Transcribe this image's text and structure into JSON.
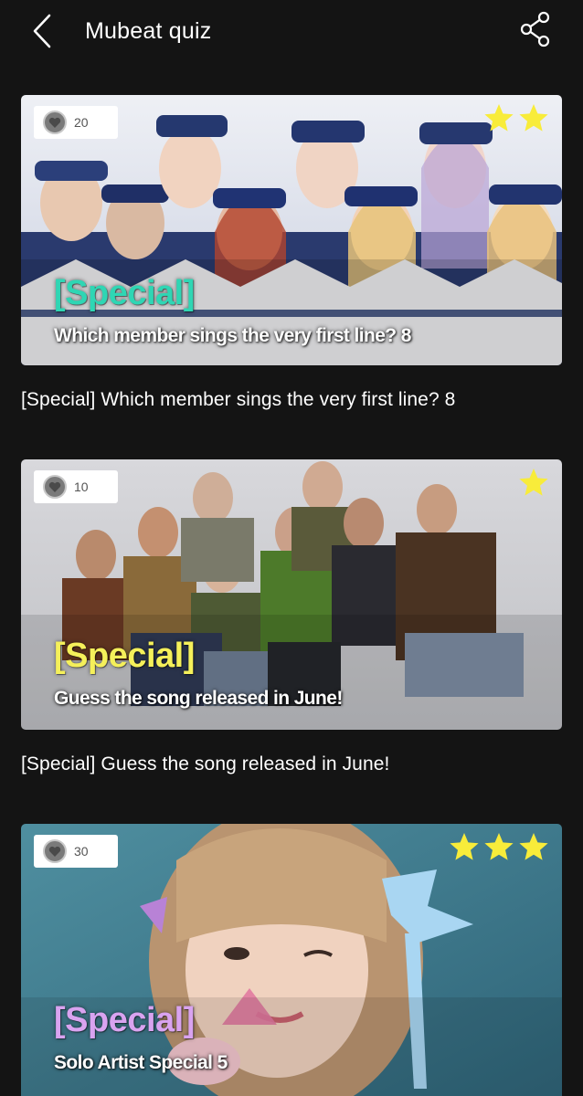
{
  "header": {
    "title": "Mubeat quiz",
    "back_icon": "chevron-left-icon",
    "share_icon": "share-icon"
  },
  "quizzes": [
    {
      "likes": "20",
      "stars": 2,
      "tag": "[Special]",
      "tag_color": "#2fd6b4",
      "image_title": "Which member sings the very first line? 8",
      "caption": "[Special] Which member sings the very first line? 8"
    },
    {
      "likes": "10",
      "stars": 1,
      "tag": "[Special]",
      "tag_color": "#f5f05a",
      "image_title": "Guess the song released in June!",
      "caption": "[Special] Guess the song released in June!"
    },
    {
      "likes": "30",
      "stars": 3,
      "tag": "[Special]",
      "tag_color": "#d9a3f0",
      "image_title": "Solo Artist Special 5",
      "caption": ""
    }
  ],
  "colors": {
    "background": "#141414",
    "star": "#f8ec3a",
    "badge": "#ffffff"
  }
}
